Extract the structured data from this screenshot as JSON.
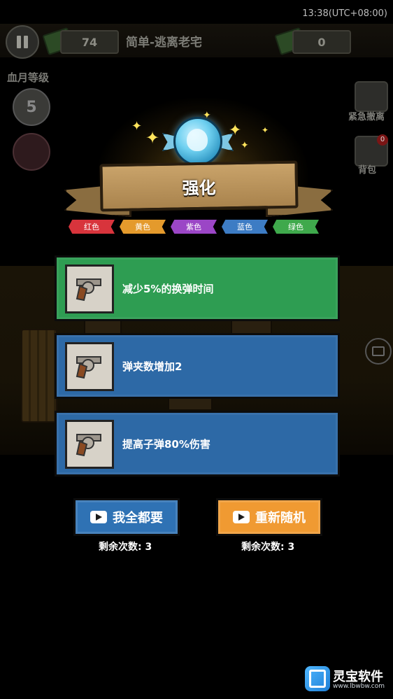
{
  "status_bar": {
    "time": "13:38(UTC+08:00)"
  },
  "hud": {
    "left_money": "74",
    "level_name": "简单-逃离老宅",
    "right_money": "0",
    "blood_moon_label": "血月等级",
    "blood_moon_level": "5",
    "emergency_label": "紧急撤离",
    "backpack_label": "背包",
    "backpack_badge": "0"
  },
  "modal": {
    "title": "强化",
    "rarity_tags": [
      {
        "label": "红色",
        "color": "#d8343c"
      },
      {
        "label": "黄色",
        "color": "#e49a2c"
      },
      {
        "label": "紫色",
        "color": "#9b46c6"
      },
      {
        "label": "蓝色",
        "color": "#3d7cc4"
      },
      {
        "label": "绿色",
        "color": "#3fa94c"
      }
    ],
    "upgrades": [
      {
        "text": "减少5%的换弹时间",
        "rarity": "green",
        "icon": "revolver-icon"
      },
      {
        "text": "弹夹数增加2",
        "rarity": "blue",
        "icon": "revolver-icon"
      },
      {
        "text": "提高子弹80%伤害",
        "rarity": "blue",
        "icon": "revolver-icon"
      }
    ],
    "take_all_button": "我全都要",
    "reroll_button": "重新随机",
    "take_all_remaining": "剩余次数: 3",
    "reroll_remaining": "剩余次数: 3"
  },
  "watermark": {
    "name": "灵宝软件",
    "url": "www.lbwbw.com"
  }
}
